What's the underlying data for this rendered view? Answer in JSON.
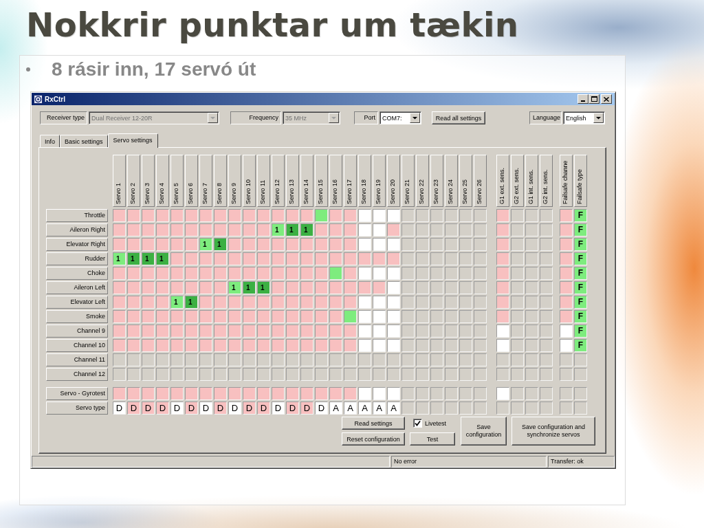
{
  "slide": {
    "title": "Nokkrir punktar um tækin",
    "bullets": [
      "8 rásir inn, 17 servó út"
    ]
  },
  "window": {
    "title": "RxCtrl"
  },
  "toolbar": {
    "fields": [
      {
        "label": "Receiver type",
        "value": "Dual Receiver 12-20R",
        "disabled": true
      },
      {
        "label": "Frequency",
        "value": "35 MHz",
        "disabled": true
      },
      {
        "label": "Port",
        "value": "COM7:",
        "disabled": false
      }
    ],
    "read_all_button": "Read all settings",
    "language": {
      "label": "Language",
      "value": "English",
      "disabled": false
    }
  },
  "tabs": [
    {
      "label": "Info",
      "selected": false
    },
    {
      "label": "Basic settings",
      "selected": false
    },
    {
      "label": "Servo settings",
      "selected": true
    }
  ],
  "servo_grid": {
    "servo_columns": [
      "Servo 1",
      "Servo 2",
      "Servo 3",
      "Servo 4",
      "Servo 5",
      "Servo 6",
      "Servo 7",
      "Servo 8",
      "Servo 9",
      "Servo 10",
      "Servo 11",
      "Servo 12",
      "Servo 13",
      "Servo 14",
      "Servo 15",
      "Servo 16",
      "Servo 17",
      "Servo 18",
      "Servo 19",
      "Servo 20",
      "Servo 21",
      "Servo 22",
      "Servo 23",
      "Servo 24",
      "Servo 25",
      "Servo 26"
    ],
    "gyro_columns": [
      "G1 ext. sens.",
      "G2 ext. sens.",
      "G1 int. sens.",
      "G2 int. sens."
    ],
    "failsafe_columns": [
      "Failsafe channe",
      "Failsafe type"
    ],
    "channel_rows": [
      {
        "label": "Throttle",
        "servo_cells": [
          {
            "kind": "off"
          },
          {
            "kind": "off"
          },
          {
            "kind": "off"
          },
          {
            "kind": "off"
          },
          {
            "kind": "off"
          },
          {
            "kind": "off"
          },
          {
            "kind": "off"
          },
          {
            "kind": "off"
          },
          {
            "kind": "off"
          },
          {
            "kind": "off"
          },
          {
            "kind": "off"
          },
          {
            "kind": "off"
          },
          {
            "kind": "off"
          },
          {
            "kind": "off"
          },
          {
            "kind": "assigned"
          },
          {
            "kind": "off"
          },
          {
            "kind": "off"
          },
          {
            "kind": "free"
          },
          {
            "kind": "free"
          },
          {
            "kind": "free"
          },
          {
            "kind": "none"
          },
          {
            "kind": "none"
          },
          {
            "kind": "none"
          },
          {
            "kind": "none"
          },
          {
            "kind": "none"
          },
          {
            "kind": "none"
          }
        ],
        "gyro_cells": [
          {
            "kind": "off"
          },
          {
            "kind": "none"
          },
          {
            "kind": "none"
          },
          {
            "kind": "none"
          }
        ],
        "failsafe_cells": [
          {
            "kind": "off"
          },
          {
            "kind": "assigned",
            "text": "F"
          }
        ]
      },
      {
        "label": "Aileron Right",
        "servo_cells": [
          {
            "kind": "off"
          },
          {
            "kind": "off"
          },
          {
            "kind": "off"
          },
          {
            "kind": "off"
          },
          {
            "kind": "off"
          },
          {
            "kind": "off"
          },
          {
            "kind": "off"
          },
          {
            "kind": "off"
          },
          {
            "kind": "off"
          },
          {
            "kind": "off"
          },
          {
            "kind": "off"
          },
          {
            "kind": "assigned",
            "text": "1"
          },
          {
            "kind": "linked",
            "text": "1"
          },
          {
            "kind": "linked",
            "text": "1"
          },
          {
            "kind": "off"
          },
          {
            "kind": "off"
          },
          {
            "kind": "off"
          },
          {
            "kind": "free"
          },
          {
            "kind": "free"
          },
          {
            "kind": "off"
          },
          {
            "kind": "none"
          },
          {
            "kind": "none"
          },
          {
            "kind": "none"
          },
          {
            "kind": "none"
          },
          {
            "kind": "none"
          },
          {
            "kind": "none"
          }
        ],
        "gyro_cells": [
          {
            "kind": "off"
          },
          {
            "kind": "none"
          },
          {
            "kind": "none"
          },
          {
            "kind": "none"
          }
        ],
        "failsafe_cells": [
          {
            "kind": "off"
          },
          {
            "kind": "assigned",
            "text": "F"
          }
        ]
      },
      {
        "label": "Elevator Right",
        "servo_cells": [
          {
            "kind": "off"
          },
          {
            "kind": "off"
          },
          {
            "kind": "off"
          },
          {
            "kind": "off"
          },
          {
            "kind": "off"
          },
          {
            "kind": "off"
          },
          {
            "kind": "assigned",
            "text": "1"
          },
          {
            "kind": "linked",
            "text": "1"
          },
          {
            "kind": "off"
          },
          {
            "kind": "off"
          },
          {
            "kind": "off"
          },
          {
            "kind": "off"
          },
          {
            "kind": "off"
          },
          {
            "kind": "off"
          },
          {
            "kind": "off"
          },
          {
            "kind": "off"
          },
          {
            "kind": "off"
          },
          {
            "kind": "free"
          },
          {
            "kind": "free"
          },
          {
            "kind": "free"
          },
          {
            "kind": "none"
          },
          {
            "kind": "none"
          },
          {
            "kind": "none"
          },
          {
            "kind": "none"
          },
          {
            "kind": "none"
          },
          {
            "kind": "none"
          }
        ],
        "gyro_cells": [
          {
            "kind": "off"
          },
          {
            "kind": "none"
          },
          {
            "kind": "none"
          },
          {
            "kind": "none"
          }
        ],
        "failsafe_cells": [
          {
            "kind": "off"
          },
          {
            "kind": "assigned",
            "text": "F"
          }
        ]
      },
      {
        "label": "Rudder",
        "servo_cells": [
          {
            "kind": "assigned",
            "text": "1"
          },
          {
            "kind": "linked",
            "text": "1"
          },
          {
            "kind": "linked",
            "text": "1"
          },
          {
            "kind": "linked",
            "text": "1"
          },
          {
            "kind": "off"
          },
          {
            "kind": "off"
          },
          {
            "kind": "off"
          },
          {
            "kind": "off"
          },
          {
            "kind": "off"
          },
          {
            "kind": "off"
          },
          {
            "kind": "off"
          },
          {
            "kind": "off"
          },
          {
            "kind": "off"
          },
          {
            "kind": "off"
          },
          {
            "kind": "off"
          },
          {
            "kind": "off"
          },
          {
            "kind": "off"
          },
          {
            "kind": "off"
          },
          {
            "kind": "off"
          },
          {
            "kind": "off"
          },
          {
            "kind": "none"
          },
          {
            "kind": "none"
          },
          {
            "kind": "none"
          },
          {
            "kind": "none"
          },
          {
            "kind": "none"
          },
          {
            "kind": "none"
          }
        ],
        "gyro_cells": [
          {
            "kind": "off"
          },
          {
            "kind": "none"
          },
          {
            "kind": "none"
          },
          {
            "kind": "none"
          }
        ],
        "failsafe_cells": [
          {
            "kind": "off"
          },
          {
            "kind": "assigned",
            "text": "F"
          }
        ]
      },
      {
        "label": "Choke",
        "servo_cells": [
          {
            "kind": "off"
          },
          {
            "kind": "off"
          },
          {
            "kind": "off"
          },
          {
            "kind": "off"
          },
          {
            "kind": "off"
          },
          {
            "kind": "off"
          },
          {
            "kind": "off"
          },
          {
            "kind": "off"
          },
          {
            "kind": "off"
          },
          {
            "kind": "off"
          },
          {
            "kind": "off"
          },
          {
            "kind": "off"
          },
          {
            "kind": "off"
          },
          {
            "kind": "off"
          },
          {
            "kind": "off"
          },
          {
            "kind": "assigned"
          },
          {
            "kind": "off"
          },
          {
            "kind": "free"
          },
          {
            "kind": "free"
          },
          {
            "kind": "free"
          },
          {
            "kind": "none"
          },
          {
            "kind": "none"
          },
          {
            "kind": "none"
          },
          {
            "kind": "none"
          },
          {
            "kind": "none"
          },
          {
            "kind": "none"
          }
        ],
        "gyro_cells": [
          {
            "kind": "off"
          },
          {
            "kind": "none"
          },
          {
            "kind": "none"
          },
          {
            "kind": "none"
          }
        ],
        "failsafe_cells": [
          {
            "kind": "off"
          },
          {
            "kind": "assigned",
            "text": "F"
          }
        ]
      },
      {
        "label": "Aileron Left",
        "servo_cells": [
          {
            "kind": "off"
          },
          {
            "kind": "off"
          },
          {
            "kind": "off"
          },
          {
            "kind": "off"
          },
          {
            "kind": "off"
          },
          {
            "kind": "off"
          },
          {
            "kind": "off"
          },
          {
            "kind": "off"
          },
          {
            "kind": "assigned",
            "text": "1"
          },
          {
            "kind": "linked",
            "text": "1"
          },
          {
            "kind": "linked",
            "text": "1"
          },
          {
            "kind": "off"
          },
          {
            "kind": "off"
          },
          {
            "kind": "off"
          },
          {
            "kind": "off"
          },
          {
            "kind": "off"
          },
          {
            "kind": "off"
          },
          {
            "kind": "off"
          },
          {
            "kind": "off"
          },
          {
            "kind": "free"
          },
          {
            "kind": "none"
          },
          {
            "kind": "none"
          },
          {
            "kind": "none"
          },
          {
            "kind": "none"
          },
          {
            "kind": "none"
          },
          {
            "kind": "none"
          }
        ],
        "gyro_cells": [
          {
            "kind": "off"
          },
          {
            "kind": "none"
          },
          {
            "kind": "none"
          },
          {
            "kind": "none"
          }
        ],
        "failsafe_cells": [
          {
            "kind": "off"
          },
          {
            "kind": "assigned",
            "text": "F"
          }
        ]
      },
      {
        "label": "Elevator Left",
        "servo_cells": [
          {
            "kind": "off"
          },
          {
            "kind": "off"
          },
          {
            "kind": "off"
          },
          {
            "kind": "off"
          },
          {
            "kind": "assigned",
            "text": "1"
          },
          {
            "kind": "linked",
            "text": "1"
          },
          {
            "kind": "off"
          },
          {
            "kind": "off"
          },
          {
            "kind": "off"
          },
          {
            "kind": "off"
          },
          {
            "kind": "off"
          },
          {
            "kind": "off"
          },
          {
            "kind": "off"
          },
          {
            "kind": "off"
          },
          {
            "kind": "off"
          },
          {
            "kind": "off"
          },
          {
            "kind": "off"
          },
          {
            "kind": "free"
          },
          {
            "kind": "free"
          },
          {
            "kind": "free"
          },
          {
            "kind": "none"
          },
          {
            "kind": "none"
          },
          {
            "kind": "none"
          },
          {
            "kind": "none"
          },
          {
            "kind": "none"
          },
          {
            "kind": "none"
          }
        ],
        "gyro_cells": [
          {
            "kind": "off"
          },
          {
            "kind": "none"
          },
          {
            "kind": "none"
          },
          {
            "kind": "none"
          }
        ],
        "failsafe_cells": [
          {
            "kind": "off"
          },
          {
            "kind": "assigned",
            "text": "F"
          }
        ]
      },
      {
        "label": "Smoke",
        "servo_cells": [
          {
            "kind": "off"
          },
          {
            "kind": "off"
          },
          {
            "kind": "off"
          },
          {
            "kind": "off"
          },
          {
            "kind": "off"
          },
          {
            "kind": "off"
          },
          {
            "kind": "off"
          },
          {
            "kind": "off"
          },
          {
            "kind": "off"
          },
          {
            "kind": "off"
          },
          {
            "kind": "off"
          },
          {
            "kind": "off"
          },
          {
            "kind": "off"
          },
          {
            "kind": "off"
          },
          {
            "kind": "off"
          },
          {
            "kind": "off"
          },
          {
            "kind": "assigned"
          },
          {
            "kind": "free"
          },
          {
            "kind": "free"
          },
          {
            "kind": "free"
          },
          {
            "kind": "none"
          },
          {
            "kind": "none"
          },
          {
            "kind": "none"
          },
          {
            "kind": "none"
          },
          {
            "kind": "none"
          },
          {
            "kind": "none"
          }
        ],
        "gyro_cells": [
          {
            "kind": "off"
          },
          {
            "kind": "none"
          },
          {
            "kind": "none"
          },
          {
            "kind": "none"
          }
        ],
        "failsafe_cells": [
          {
            "kind": "off"
          },
          {
            "kind": "assigned",
            "text": "F"
          }
        ]
      },
      {
        "label": "Channel 9",
        "servo_cells": [
          {
            "kind": "off"
          },
          {
            "kind": "off"
          },
          {
            "kind": "off"
          },
          {
            "kind": "off"
          },
          {
            "kind": "off"
          },
          {
            "kind": "off"
          },
          {
            "kind": "off"
          },
          {
            "kind": "off"
          },
          {
            "kind": "off"
          },
          {
            "kind": "off"
          },
          {
            "kind": "off"
          },
          {
            "kind": "off"
          },
          {
            "kind": "off"
          },
          {
            "kind": "off"
          },
          {
            "kind": "off"
          },
          {
            "kind": "off"
          },
          {
            "kind": "off"
          },
          {
            "kind": "free"
          },
          {
            "kind": "free"
          },
          {
            "kind": "free"
          },
          {
            "kind": "none"
          },
          {
            "kind": "none"
          },
          {
            "kind": "none"
          },
          {
            "kind": "none"
          },
          {
            "kind": "none"
          },
          {
            "kind": "none"
          }
        ],
        "gyro_cells": [
          {
            "kind": "free"
          },
          {
            "kind": "none"
          },
          {
            "kind": "none"
          },
          {
            "kind": "none"
          }
        ],
        "failsafe_cells": [
          {
            "kind": "free"
          },
          {
            "kind": "assigned",
            "text": "F"
          }
        ]
      },
      {
        "label": "Channel 10",
        "servo_cells": [
          {
            "kind": "off"
          },
          {
            "kind": "off"
          },
          {
            "kind": "off"
          },
          {
            "kind": "off"
          },
          {
            "kind": "off"
          },
          {
            "kind": "off"
          },
          {
            "kind": "off"
          },
          {
            "kind": "off"
          },
          {
            "kind": "off"
          },
          {
            "kind": "off"
          },
          {
            "kind": "off"
          },
          {
            "kind": "off"
          },
          {
            "kind": "off"
          },
          {
            "kind": "off"
          },
          {
            "kind": "off"
          },
          {
            "kind": "off"
          },
          {
            "kind": "off"
          },
          {
            "kind": "free"
          },
          {
            "kind": "free"
          },
          {
            "kind": "free"
          },
          {
            "kind": "none"
          },
          {
            "kind": "none"
          },
          {
            "kind": "none"
          },
          {
            "kind": "none"
          },
          {
            "kind": "none"
          },
          {
            "kind": "none"
          }
        ],
        "gyro_cells": [
          {
            "kind": "free"
          },
          {
            "kind": "none"
          },
          {
            "kind": "none"
          },
          {
            "kind": "none"
          }
        ],
        "failsafe_cells": [
          {
            "kind": "free"
          },
          {
            "kind": "assigned",
            "text": "F"
          }
        ]
      },
      {
        "label": "Channel 11",
        "servo_cells": [
          {
            "kind": "none"
          },
          {
            "kind": "none"
          },
          {
            "kind": "none"
          },
          {
            "kind": "none"
          },
          {
            "kind": "none"
          },
          {
            "kind": "none"
          },
          {
            "kind": "none"
          },
          {
            "kind": "none"
          },
          {
            "kind": "none"
          },
          {
            "kind": "none"
          },
          {
            "kind": "none"
          },
          {
            "kind": "none"
          },
          {
            "kind": "none"
          },
          {
            "kind": "none"
          },
          {
            "kind": "none"
          },
          {
            "kind": "none"
          },
          {
            "kind": "none"
          },
          {
            "kind": "none"
          },
          {
            "kind": "none"
          },
          {
            "kind": "none"
          },
          {
            "kind": "none"
          },
          {
            "kind": "none"
          },
          {
            "kind": "none"
          },
          {
            "kind": "none"
          },
          {
            "kind": "none"
          },
          {
            "kind": "none"
          }
        ],
        "gyro_cells": [
          {
            "kind": "none"
          },
          {
            "kind": "none"
          },
          {
            "kind": "none"
          },
          {
            "kind": "none"
          }
        ],
        "failsafe_cells": [
          {
            "kind": "none"
          },
          {
            "kind": "none"
          }
        ]
      },
      {
        "label": "Channel 12",
        "servo_cells": [
          {
            "kind": "none"
          },
          {
            "kind": "none"
          },
          {
            "kind": "none"
          },
          {
            "kind": "none"
          },
          {
            "kind": "none"
          },
          {
            "kind": "none"
          },
          {
            "kind": "none"
          },
          {
            "kind": "none"
          },
          {
            "kind": "none"
          },
          {
            "kind": "none"
          },
          {
            "kind": "none"
          },
          {
            "kind": "none"
          },
          {
            "kind": "none"
          },
          {
            "kind": "none"
          },
          {
            "kind": "none"
          },
          {
            "kind": "none"
          },
          {
            "kind": "none"
          },
          {
            "kind": "none"
          },
          {
            "kind": "none"
          },
          {
            "kind": "none"
          },
          {
            "kind": "none"
          },
          {
            "kind": "none"
          },
          {
            "kind": "none"
          },
          {
            "kind": "none"
          },
          {
            "kind": "none"
          },
          {
            "kind": "none"
          }
        ],
        "gyro_cells": [
          {
            "kind": "none"
          },
          {
            "kind": "none"
          },
          {
            "kind": "none"
          },
          {
            "kind": "none"
          }
        ],
        "failsafe_cells": [
          {
            "kind": "none"
          },
          {
            "kind": "none"
          }
        ]
      }
    ],
    "extra_rows": [
      {
        "label": "Servo - Gyrotest",
        "servo_cells": [
          {
            "kind": "off"
          },
          {
            "kind": "off"
          },
          {
            "kind": "off"
          },
          {
            "kind": "off"
          },
          {
            "kind": "off"
          },
          {
            "kind": "off"
          },
          {
            "kind": "off"
          },
          {
            "kind": "off"
          },
          {
            "kind": "off"
          },
          {
            "kind": "off"
          },
          {
            "kind": "off"
          },
          {
            "kind": "off"
          },
          {
            "kind": "off"
          },
          {
            "kind": "off"
          },
          {
            "kind": "off"
          },
          {
            "kind": "off"
          },
          {
            "kind": "off"
          },
          {
            "kind": "free"
          },
          {
            "kind": "free"
          },
          {
            "kind": "free"
          },
          {
            "kind": "none"
          },
          {
            "kind": "none"
          },
          {
            "kind": "none"
          },
          {
            "kind": "none"
          },
          {
            "kind": "none"
          },
          {
            "kind": "none"
          }
        ],
        "gyro_cells": [
          {
            "kind": "free"
          },
          {
            "kind": "none"
          },
          {
            "kind": "none"
          },
          {
            "kind": "none"
          }
        ],
        "failsafe_cells": [
          {
            "kind": "none"
          },
          {
            "kind": "none"
          }
        ]
      },
      {
        "label": "Servo type",
        "servo_cells": [
          {
            "kind": "free",
            "text": "D"
          },
          {
            "kind": "off",
            "text": "D"
          },
          {
            "kind": "off",
            "text": "D"
          },
          {
            "kind": "off",
            "text": "D"
          },
          {
            "kind": "free",
            "text": "D"
          },
          {
            "kind": "off",
            "text": "D"
          },
          {
            "kind": "free",
            "text": "D"
          },
          {
            "kind": "off",
            "text": "D"
          },
          {
            "kind": "free",
            "text": "D"
          },
          {
            "kind": "off",
            "text": "D"
          },
          {
            "kind": "off",
            "text": "D"
          },
          {
            "kind": "free",
            "text": "D"
          },
          {
            "kind": "off",
            "text": "D"
          },
          {
            "kind": "off",
            "text": "D"
          },
          {
            "kind": "free",
            "text": "D"
          },
          {
            "kind": "free",
            "text": "A"
          },
          {
            "kind": "free",
            "text": "A"
          },
          {
            "kind": "free",
            "text": "A"
          },
          {
            "kind": "free",
            "text": "A"
          },
          {
            "kind": "free",
            "text": "A"
          },
          {
            "kind": "none"
          },
          {
            "kind": "none"
          },
          {
            "kind": "none"
          },
          {
            "kind": "none"
          },
          {
            "kind": "none"
          },
          {
            "kind": "none"
          }
        ],
        "gyro_cells": [
          {
            "kind": "none"
          },
          {
            "kind": "none"
          },
          {
            "kind": "none"
          },
          {
            "kind": "none"
          }
        ],
        "failsafe_cells": [
          {
            "kind": "none"
          },
          {
            "kind": "none"
          }
        ]
      }
    ]
  },
  "actions": {
    "left_buttons": [
      "Read settings",
      "Reset configuration"
    ],
    "livetest": {
      "label": "Livetest",
      "checked": true
    },
    "test_button": "Test",
    "save_buttons": [
      "Save configuration",
      "Save configuration and synchronize servos"
    ]
  },
  "status_bar": {
    "message": "No error",
    "transfer": "Transfer: ok"
  }
}
